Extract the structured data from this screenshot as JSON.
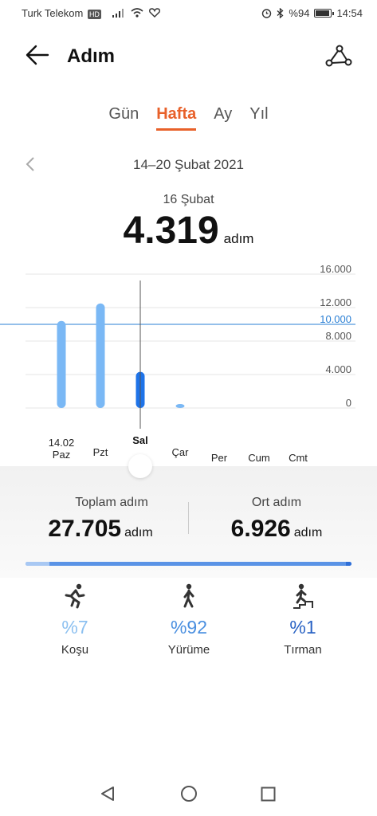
{
  "status_bar": {
    "carrier": "Turk Telekom",
    "hd": "HD",
    "battery": "%94",
    "time": "14:54"
  },
  "header": {
    "title": "Adım"
  },
  "tabs": [
    {
      "label": "Gün"
    },
    {
      "label": "Hafta",
      "active": true
    },
    {
      "label": "Ay"
    },
    {
      "label": "Yıl"
    }
  ],
  "date_range": "14–20 Şubat 2021",
  "selected": {
    "date": "16 Şubat",
    "steps": "4.319",
    "unit": "adım"
  },
  "chart_data": {
    "type": "bar",
    "categories": [
      "Paz",
      "Pzt",
      "Sal",
      "Çar",
      "Per",
      "Cum",
      "Cmt"
    ],
    "date_label": "14.02",
    "values": [
      10400,
      12500,
      4319,
      200,
      0,
      0,
      0
    ],
    "ylim": [
      0,
      16000
    ],
    "yticks": [
      "16.000",
      "12.000",
      "10.000",
      "8.000",
      "4.000",
      "0"
    ],
    "target_line": 10000,
    "selected_index": 2,
    "colors": {
      "bar": "#7ab8f5",
      "selected_bar": "#1e73e8",
      "target": "#2a7fd4"
    }
  },
  "summary": {
    "total": {
      "label": "Toplam adım",
      "value": "27.705",
      "unit": "adım"
    },
    "average": {
      "label": "Ort adım",
      "value": "6.926",
      "unit": "adım"
    }
  },
  "activities": [
    {
      "icon": "running-icon",
      "pct": "%7",
      "name": "Koşu",
      "color": "#8cc0f0"
    },
    {
      "icon": "walking-icon",
      "pct": "%92",
      "name": "Yürüme",
      "color": "#4a8fe0"
    },
    {
      "icon": "climbing-icon",
      "pct": "%1",
      "name": "Tırman",
      "color": "#2a63c4"
    }
  ]
}
